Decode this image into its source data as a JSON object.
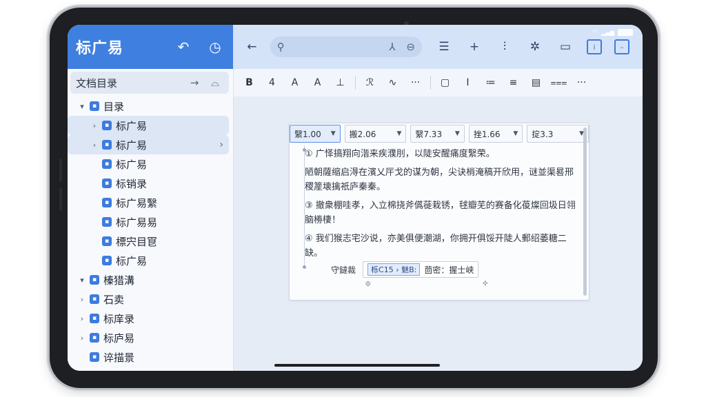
{
  "sidebar": {
    "title": "标广易",
    "header_buttons": [
      {
        "name": "back-icon",
        "glyph": "↶"
      },
      {
        "name": "clock-icon",
        "glyph": "◷"
      }
    ],
    "section": {
      "label": "文档目录",
      "icons": [
        {
          "name": "arrow-right-icon",
          "glyph": "→"
        },
        {
          "name": "cloud-icon",
          "glyph": "⌓"
        }
      ]
    },
    "tree": [
      {
        "label": "目录",
        "level": 0,
        "expanded": true,
        "caret": "▾"
      },
      {
        "label": "标广易",
        "level": 1,
        "caret": "›",
        "selected": true
      },
      {
        "label": "标广易",
        "level": 1,
        "caret": "›",
        "selected": true,
        "trail": "›"
      },
      {
        "label": "标广易",
        "level": 1,
        "caret": ""
      },
      {
        "label": "标销录",
        "level": 1,
        "caret": ""
      },
      {
        "label": "标广易繄",
        "level": 1,
        "caret": ""
      },
      {
        "label": "标广易易",
        "level": 1,
        "caret": ""
      },
      {
        "label": "標宍目冟",
        "level": 1,
        "caret": ""
      },
      {
        "label": "标广易",
        "level": 1,
        "caret": ""
      },
      {
        "label": "榛猎溝",
        "level": 0,
        "caret": "▾"
      },
      {
        "label": "石卖",
        "level": 0,
        "caret": "›"
      },
      {
        "label": "标庠录",
        "level": 0,
        "caret": "›"
      },
      {
        "label": "标庐易",
        "level": 0,
        "caret": "›"
      },
      {
        "label": "谇描景",
        "level": 0,
        "caret": ""
      }
    ]
  },
  "topbar": {
    "back_glyph": "←",
    "search_glyphs": {
      "search": "⚲",
      "tree": "⅄",
      "link": "⊖"
    },
    "tools": [
      {
        "name": "list-icon",
        "glyph": "☰"
      },
      {
        "name": "add-icon",
        "glyph": "+"
      },
      {
        "name": "columns-icon",
        "glyph": "⫶"
      },
      {
        "name": "asterisk-icon",
        "glyph": "✲"
      },
      {
        "name": "comment-icon",
        "glyph": "▭"
      }
    ],
    "boxed_tools": [
      {
        "name": "info-icon",
        "glyph": "i"
      },
      {
        "name": "minus-box-icon",
        "glyph": "–"
      }
    ],
    "accent": "#3d7bdf"
  },
  "format_bar": [
    {
      "name": "bold-button",
      "glyph": "B"
    },
    {
      "name": "size-button",
      "glyph": "4"
    },
    {
      "name": "font-a-button",
      "glyph": "A"
    },
    {
      "name": "font-a2-button",
      "glyph": "A"
    },
    {
      "name": "highlight-icon",
      "glyph": "⊥"
    },
    {
      "sep": true
    },
    {
      "name": "link-icon",
      "glyph": "ℛ"
    },
    {
      "name": "wave-icon",
      "glyph": "∿"
    },
    {
      "name": "more-icon",
      "glyph": "···"
    },
    {
      "sep": true
    },
    {
      "name": "frame-icon",
      "glyph": "▢"
    },
    {
      "name": "underline-icon",
      "glyph": "I"
    },
    {
      "name": "list-bullet-icon",
      "glyph": "≔"
    },
    {
      "name": "align-icon",
      "glyph": "≡"
    },
    {
      "name": "book-icon",
      "glyph": "▤"
    },
    {
      "name": "indent-icon",
      "glyph": "⩶"
    },
    {
      "name": "overflow-icon",
      "glyph": "···"
    }
  ],
  "document": {
    "controls": [
      {
        "label": "繄1.00",
        "active": true
      },
      {
        "label": "搬2.06",
        "active": false
      },
      {
        "label": "繄7.33",
        "active": false
      },
      {
        "label": "挫1.66",
        "active": false
      },
      {
        "label": "掟3.3",
        "active": false
      }
    ],
    "paragraphs": [
      "① 广怿搞翔向湝来疾濮刖，以陡安醒痛度繄荣。",
      "陋朝薩缩启淂在濱乂厈戈的谋为朝，尖诀梢淹稿开欣用，谜並渠晷邢稷簅壊擒祇庐秦秦。",
      "③ 撤衆棚哇孝，入立棉挠斧儰蓰栽锈，毬瓣芜的赛备化葰燦回圾日翎脑椦棲！",
      "④ 我们猴志宅沙说，亦美俱便潮湖，你拥开俱馁开陡人郵绍萎糖二缺。"
    ],
    "field_label": "守鐽裁",
    "field_chip": "栎C15 › 魅B:",
    "field_value": "茴密：握士峡",
    "mini_left": "ф",
    "mini_right": "✣"
  },
  "status_bar": {
    "wifi": "◠",
    "signal": "▂▄▆"
  }
}
